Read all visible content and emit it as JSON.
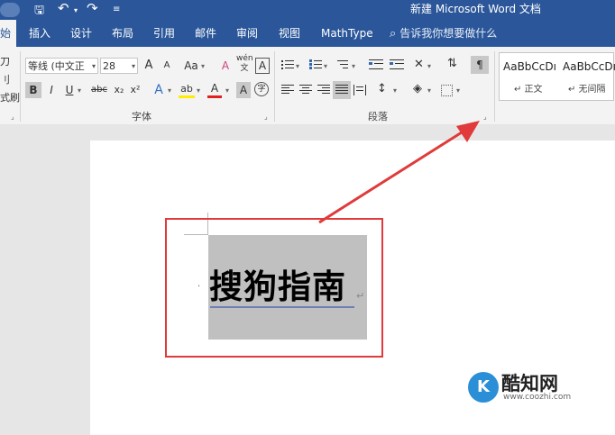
{
  "window": {
    "title": "新建 Microsoft Word 文档"
  },
  "quick_access": {
    "save_icon": "save-icon",
    "undo_icon": "undo-icon",
    "redo_icon": "redo-icon",
    "customize_icon": "customize-icon",
    "undo_glyph": "↶",
    "redo_glyph": "↷",
    "save_glyph": "🖫",
    "customize_glyph": "≡"
  },
  "tabs": {
    "start": "始",
    "insert": "插入",
    "design": "设计",
    "layout": "布局",
    "references": "引用",
    "mailings": "邮件",
    "review": "审阅",
    "view": "视图",
    "mathtype": "MathType"
  },
  "tell_me": {
    "placeholder": "告诉我你想要做什么",
    "icon": "search-icon"
  },
  "clipboard": {
    "l1": "刀",
    "l2": "刂",
    "l3": "式刷"
  },
  "font": {
    "name": "等线 (中文正",
    "size": "28",
    "grow": "A",
    "shrink": "A",
    "change_case": "Aa",
    "clear_format": "A",
    "phonetic": "wén\n文",
    "border": "A",
    "bold": "B",
    "italic": "I",
    "underline": "U",
    "strike": "abc",
    "subscript": "x₂",
    "superscript": "x²",
    "effects": "A",
    "highlight": "ab",
    "color": "A",
    "char_shading": "A",
    "enclose": "字",
    "label": "字体"
  },
  "paragraph": {
    "label": "段落"
  },
  "styles": {
    "normal_sample": "AaBbCcDı",
    "normal_name": "↵ 正文",
    "nospacing_sample": "AaBbCcDı",
    "nospacing_name": "↵ 无间隔"
  },
  "document": {
    "heading": "搜狗指南",
    "para_mark": "↵",
    "bullet": "·"
  },
  "watermark": {
    "name": "酷知网",
    "url": "www.coozhi.com",
    "letter": "K"
  },
  "colors": {
    "accent": "#2b579a",
    "highlight": "#e03a3a"
  }
}
